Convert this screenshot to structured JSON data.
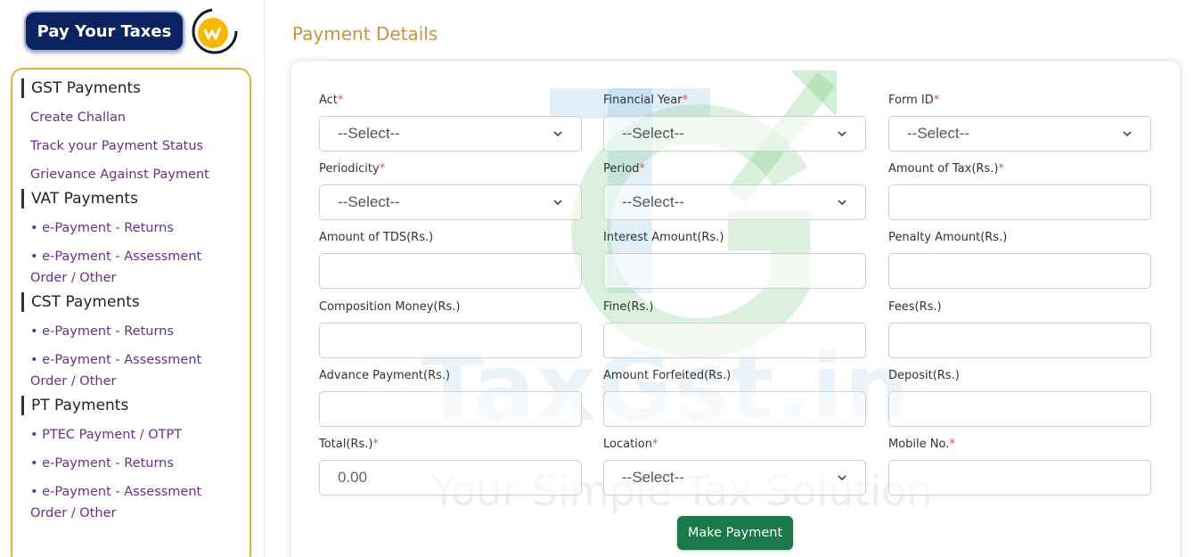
{
  "header": {
    "pay_taxes_label": "Pay Your Taxes"
  },
  "sidebar": {
    "sections": [
      {
        "heading": "GST Payments",
        "links": [
          "Create Challan",
          "Track your Payment Status",
          "Grievance Against Payment"
        ]
      },
      {
        "heading": "VAT Payments",
        "links": [
          "• e-Payment - Returns",
          "• e-Payment - Assessment",
          "Order / Other"
        ]
      },
      {
        "heading": "CST Payments",
        "links": [
          "• e-Payment - Returns",
          "• e-Payment - Assessment",
          "Order / Other"
        ]
      },
      {
        "heading": "PT Payments",
        "links": [
          "• PTEC Payment / OTPT",
          "• e-Payment - Returns",
          "• e-Payment - Assessment",
          "Order / Other"
        ]
      }
    ]
  },
  "main": {
    "title": "Payment Details",
    "watermark": {
      "main": "TaxGst.in",
      "sub": "Your Simple Tax Solution"
    },
    "fields": [
      {
        "label": "Act",
        "required": "*",
        "type": "select",
        "value": "--Select--"
      },
      {
        "label": "Financial Year",
        "required": "*",
        "type": "select",
        "value": "--Select--"
      },
      {
        "label": "Form ID",
        "required": "*",
        "type": "select",
        "value": "--Select--"
      },
      {
        "label": "Periodicity",
        "required": "*",
        "type": "select",
        "value": "--Select--"
      },
      {
        "label": "Period",
        "required": "*",
        "type": "select",
        "value": "--Select--"
      },
      {
        "label": "Amount of Tax(Rs.)",
        "required": "*",
        "type": "input",
        "value": ""
      },
      {
        "label": "Amount of TDS(Rs.)",
        "required": "",
        "type": "input",
        "value": ""
      },
      {
        "label": "Interest Amount(Rs.)",
        "required": "",
        "type": "input",
        "value": ""
      },
      {
        "label": "Penalty Amount(Rs.)",
        "required": "",
        "type": "input",
        "value": ""
      },
      {
        "label": "Composition Money(Rs.)",
        "required": "",
        "type": "input",
        "value": ""
      },
      {
        "label": "Fine(Rs.)",
        "required": "",
        "type": "input",
        "value": ""
      },
      {
        "label": "Fees(Rs.)",
        "required": "",
        "type": "input",
        "value": ""
      },
      {
        "label": "Advance Payment(Rs.)",
        "required": "",
        "type": "input",
        "value": ""
      },
      {
        "label": "Amount Forfeited(Rs.)",
        "required": "",
        "type": "input",
        "value": ""
      },
      {
        "label": "Deposit(Rs.)",
        "required": "",
        "type": "input",
        "value": ""
      },
      {
        "label": "Total(Rs.)",
        "required": "*",
        "type": "input",
        "value": "0.00"
      },
      {
        "label": "Location",
        "required": "*",
        "type": "select",
        "value": "--Select--"
      },
      {
        "label": "Mobile No.",
        "required": "*",
        "type": "input",
        "value": ""
      }
    ],
    "submit_label": "Make Payment"
  },
  "colors": {
    "brand_navy": "#0b2361",
    "title_gold": "#c9943f",
    "link_purple": "#6a2f8a",
    "border_gold": "#e3b341",
    "button_green": "#1a7a4a"
  }
}
